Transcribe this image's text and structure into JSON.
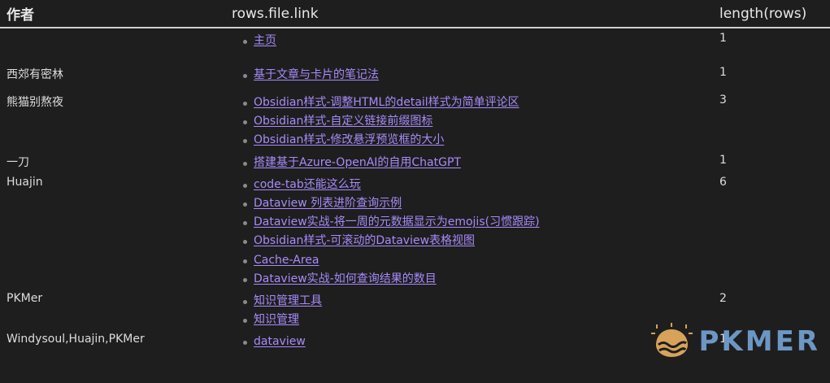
{
  "table": {
    "headers": [
      "作者",
      "rows.file.link",
      "length(rows)"
    ],
    "rows": [
      {
        "author": "",
        "links": [
          "主页"
        ],
        "count": "1"
      },
      {
        "author": "西郊有密林",
        "links": [
          "基于文章与卡片的笔记法"
        ],
        "count": "1"
      },
      {
        "author": "熊猫别熬夜",
        "links": [
          "Obsidian样式-调整HTML的detail样式为简单评论区",
          "Obsidian样式-自定义链接前缀图标",
          "Obsidian样式-修改悬浮预览框的大小"
        ],
        "count": "3"
      },
      {
        "author": "一刀",
        "links": [
          "搭建基于Azure-OpenAI的自用ChatGPT"
        ],
        "count": "1"
      },
      {
        "author": "Huajin",
        "links": [
          "code-tab还能这么玩",
          "Dataview 列表进阶查询示例",
          "Dataview实战-将一周的元数据显示为emojis(习惯跟踪)",
          "Obsidian样式-可滚动的Dataview表格视图",
          "Cache-Area",
          "Dataview实战-如何查询结果的数目"
        ],
        "count": "6"
      },
      {
        "author": "PKMer",
        "links": [
          "知识管理工具",
          "知识管理"
        ],
        "count": "2"
      },
      {
        "author": "Windysoul,Huajin,PKMer",
        "links": [
          "dataview"
        ],
        "count": "1"
      }
    ]
  },
  "watermark": {
    "text": "PKMER",
    "icon": "pkmer-logo-icon",
    "colors": {
      "text": "#6c97c4",
      "icon": "#d7a35a"
    }
  },
  "colors": {
    "background": "#1e1e1e",
    "link": "#a88bfa",
    "text": "#dcddde",
    "header_rule": "#cfcfcf"
  }
}
